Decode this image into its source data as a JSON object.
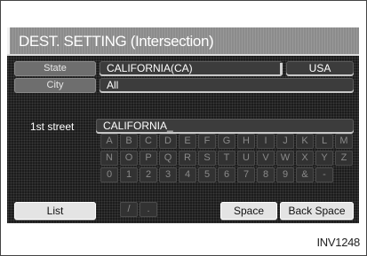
{
  "title": "DEST. SETTING (Intersection)",
  "state": {
    "label": "State",
    "value": "CALIFORNIA(CA)",
    "country": "USA"
  },
  "city": {
    "label": "City",
    "value": "All"
  },
  "street": {
    "label": "1st street",
    "value": "CALIFORNIA_"
  },
  "keyboard": {
    "rows": [
      [
        "A",
        "B",
        "C",
        "D",
        "E",
        "F",
        "G",
        "H",
        "I",
        "J",
        "K",
        "L",
        "M"
      ],
      [
        "N",
        "O",
        "P",
        "Q",
        "R",
        "S",
        "T",
        "U",
        "V",
        "W",
        "X",
        "Y",
        "Z"
      ],
      [
        "0",
        "1",
        "2",
        "3",
        "4",
        "5",
        "6",
        "7",
        "8",
        "9",
        "&",
        "-"
      ],
      [
        "/",
        "."
      ]
    ]
  },
  "buttons": {
    "list": "List",
    "space": "Space",
    "backspace": "Back Space"
  },
  "figure_code": "INV1248"
}
